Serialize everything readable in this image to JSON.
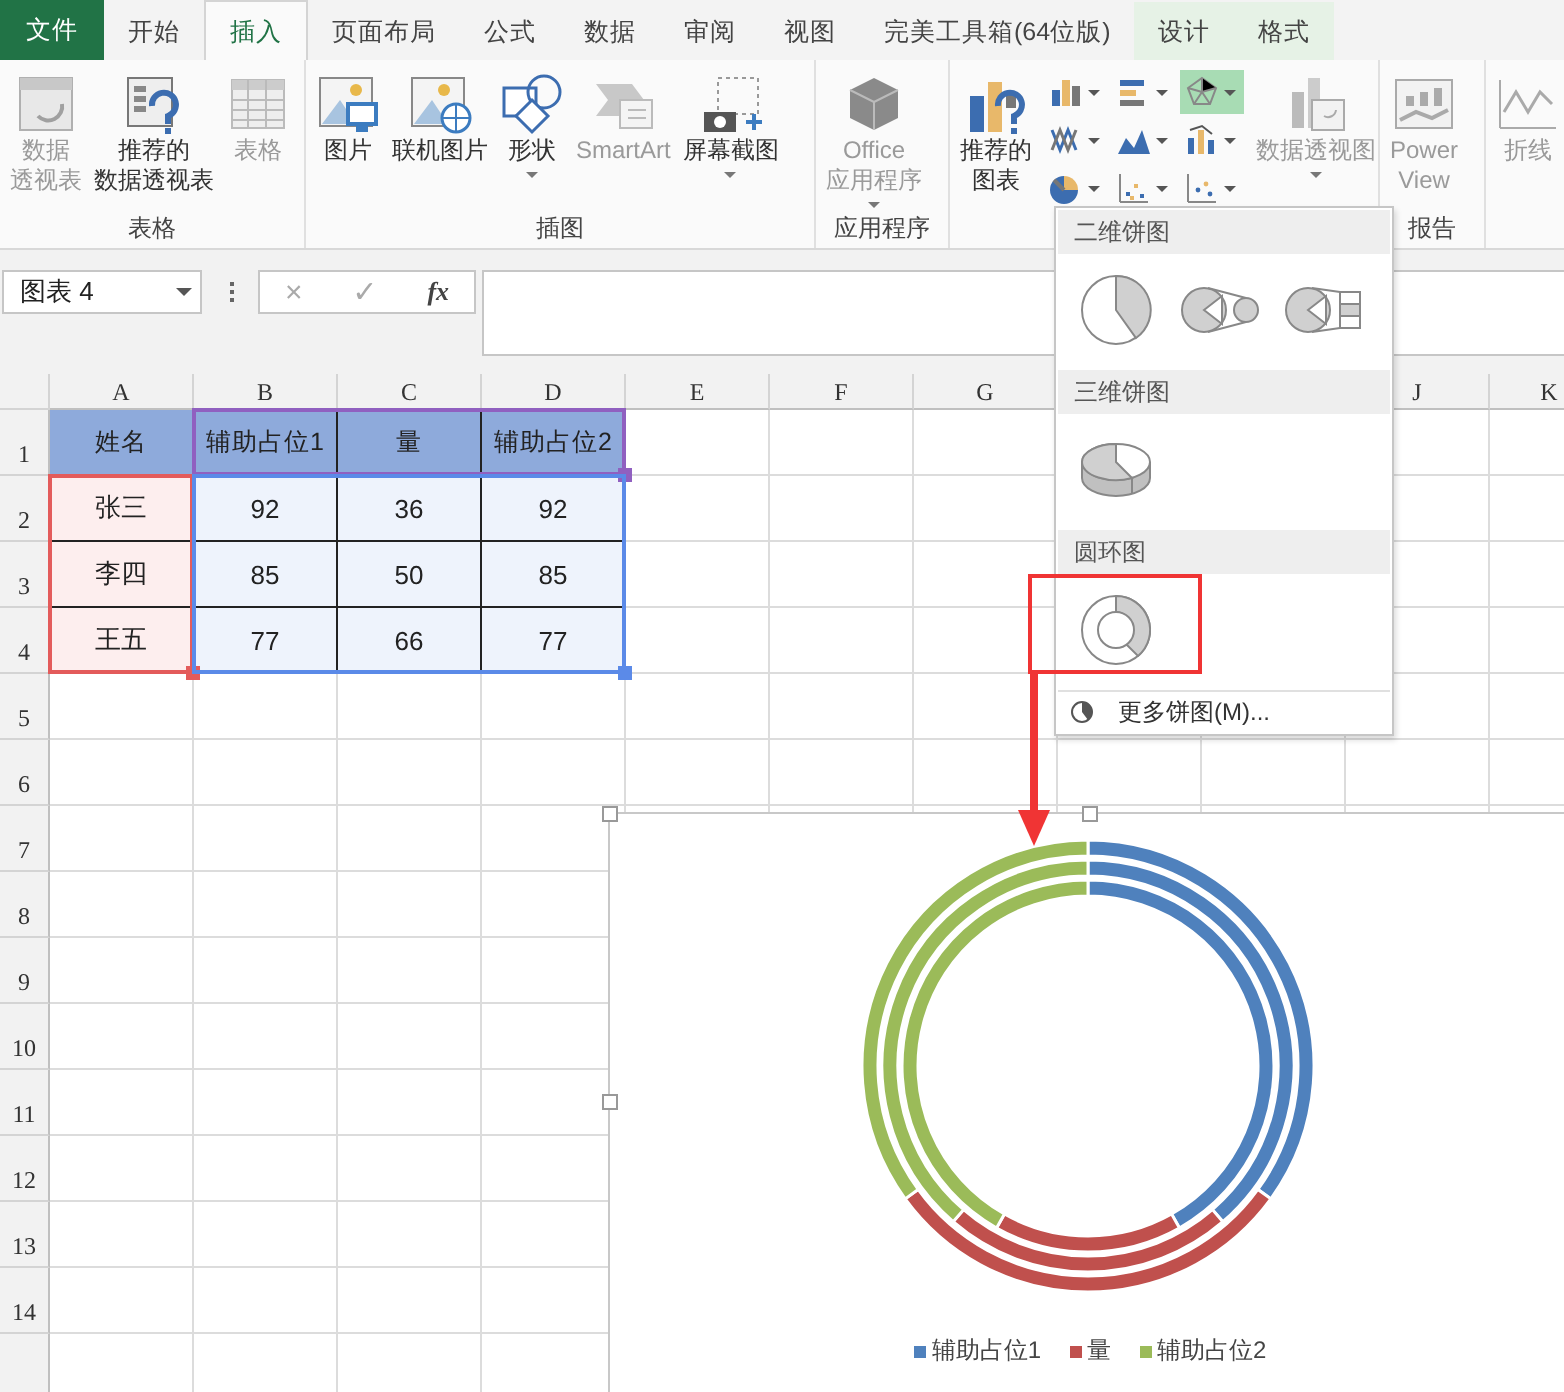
{
  "tabs": [
    {
      "label": "文件",
      "kind": "file",
      "selected": false
    },
    {
      "label": "开始",
      "kind": "normal",
      "selected": false
    },
    {
      "label": "插入",
      "kind": "normal",
      "selected": true
    },
    {
      "label": "页面布局",
      "kind": "normal",
      "selected": false
    },
    {
      "label": "公式",
      "kind": "normal",
      "selected": false
    },
    {
      "label": "数据",
      "kind": "normal",
      "selected": false
    },
    {
      "label": "审阅",
      "kind": "normal",
      "selected": false
    },
    {
      "label": "视图",
      "kind": "normal",
      "selected": false
    },
    {
      "label": "完美工具箱(64位版)",
      "kind": "normal",
      "selected": false
    },
    {
      "label": "设计",
      "kind": "contextual",
      "selected": false
    },
    {
      "label": "格式",
      "kind": "contextual",
      "selected": false
    }
  ],
  "ribbon": {
    "groups": [
      {
        "label": "表格",
        "items": [
          {
            "kind": "large",
            "lines": [
              "数据",
              "透视表"
            ],
            "disabled": true,
            "dropdown": false
          },
          {
            "kind": "large",
            "lines": [
              "推荐的",
              "数据透视表"
            ],
            "disabled": false,
            "dropdown": false
          },
          {
            "kind": "large",
            "lines": [
              "表格"
            ],
            "disabled": true,
            "dropdown": false
          }
        ]
      },
      {
        "label": "插图",
        "items": [
          {
            "kind": "large",
            "lines": [
              "图片"
            ],
            "disabled": false,
            "dropdown": false
          },
          {
            "kind": "large",
            "lines": [
              "联机图片"
            ],
            "disabled": false,
            "dropdown": false
          },
          {
            "kind": "large",
            "lines": [
              "形状"
            ],
            "disabled": false,
            "dropdown": true
          },
          {
            "kind": "large",
            "lines": [
              "SmartArt"
            ],
            "disabled": true,
            "dropdown": false
          },
          {
            "kind": "large",
            "lines": [
              "屏幕截图"
            ],
            "disabled": false,
            "dropdown": true
          }
        ]
      },
      {
        "label": "应用程序",
        "items": [
          {
            "kind": "large",
            "lines": [
              "Office",
              "应用程序"
            ],
            "disabled": true,
            "dropdown": true
          }
        ]
      },
      {
        "items": [
          {
            "kind": "large",
            "lines": [
              "推荐的",
              "图表"
            ],
            "disabled": false,
            "dropdown": false
          },
          {
            "kind": "small",
            "selected": false
          },
          {
            "kind": "small",
            "selected": false
          },
          {
            "kind": "small",
            "selected": true
          },
          {
            "kind": "small",
            "selected": false
          },
          {
            "kind": "small",
            "selected": false
          },
          {
            "kind": "small",
            "selected": false
          },
          {
            "kind": "small",
            "selected": false
          },
          {
            "kind": "small",
            "selected": false
          },
          {
            "kind": "small",
            "selected": false
          },
          {
            "kind": "large",
            "lines": [
              "数据透视图"
            ],
            "disabled": true,
            "dropdown": true
          }
        ]
      },
      {
        "label": "报告",
        "items": [
          {
            "kind": "large",
            "lines": [
              "Power",
              "View"
            ],
            "disabled": true,
            "dropdown": false
          }
        ]
      },
      {
        "items": [
          {
            "kind": "large",
            "lines": [
              "折线"
            ],
            "disabled": true,
            "dropdown": false
          }
        ]
      }
    ]
  },
  "name_box": {
    "value": "图表 4"
  },
  "formula_bar": {
    "cancel": "×",
    "enter": "✓",
    "function": "fx"
  },
  "sheet": {
    "columns": [
      {
        "label": "A"
      },
      {
        "label": "B"
      },
      {
        "label": "C"
      },
      {
        "label": "D"
      },
      {
        "label": "E"
      },
      {
        "label": "F"
      },
      {
        "label": "G"
      },
      {},
      {},
      {
        "label": "J"
      },
      {
        "label": "K"
      }
    ],
    "rows": [
      {
        "number": "1",
        "cells": [
          "姓名",
          "辅助占位1",
          "量",
          "辅助占位2"
        ]
      },
      {
        "number": "2",
        "cells": [
          "张三",
          "92",
          "36",
          "92"
        ]
      },
      {
        "number": "3",
        "cells": [
          "李四",
          "85",
          "50",
          "85"
        ]
      },
      {
        "number": "4",
        "cells": [
          "王五",
          "77",
          "66",
          "77"
        ]
      },
      {
        "number": "5",
        "cells": []
      },
      {
        "number": "6",
        "cells": []
      },
      {
        "number": "7",
        "cells": []
      },
      {
        "number": "8",
        "cells": []
      },
      {
        "number": "9",
        "cells": []
      },
      {
        "number": "10",
        "cells": []
      },
      {
        "number": "11",
        "cells": []
      },
      {
        "number": "12",
        "cells": []
      },
      {
        "number": "13",
        "cells": []
      },
      {
        "number": "14",
        "cells": []
      },
      {
        "cells": []
      }
    ],
    "highlights": [
      {
        "kind": "categories",
        "color": "#e35b5b"
      },
      {
        "kind": "series_names",
        "color": "#9060c0"
      },
      {
        "kind": "values",
        "color": "#5b8ae8"
      }
    ]
  },
  "pie_menu": {
    "sections": [
      {
        "title": "二维饼图",
        "options": [
          {
            "kind": "pie"
          },
          {
            "kind": "pie_of_pie"
          },
          {
            "kind": "bar_of_pie"
          }
        ]
      },
      {
        "title": "三维饼图",
        "options": [
          {
            "kind": "pie_3d"
          }
        ]
      },
      {
        "title": "圆环图",
        "options": [
          {
            "kind": "donut"
          }
        ]
      }
    ],
    "footer": "更多饼图(M)..."
  },
  "chart": {
    "chart_data": {
      "type": "donut",
      "categories": [
        "辅助占位1",
        "量",
        "辅助占位2"
      ],
      "colors": [
        "#4f81bd",
        "#c0504d",
        "#9bbb59"
      ],
      "series": [
        {
          "values": [
            41.82,
            16.36,
            41.82
          ]
        },
        {
          "values": [
            38.64,
            22.72,
            38.64
          ]
        },
        {
          "values": [
            35,
            30,
            35
          ]
        }
      ]
    }
  }
}
